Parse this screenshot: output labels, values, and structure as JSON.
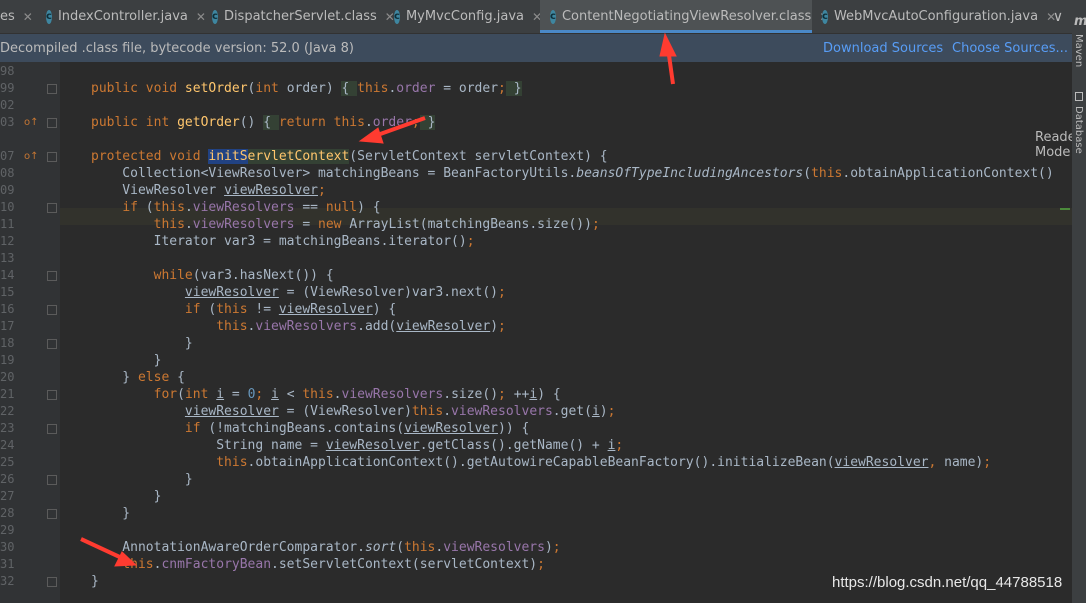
{
  "tabs": [
    {
      "label": "es",
      "icon": "none"
    },
    {
      "label": "IndexController.java",
      "icon": "class-icon"
    },
    {
      "label": "DispatcherServlet.class",
      "icon": "class-icon"
    },
    {
      "label": "MyMvcConfig.java",
      "icon": "class-icon"
    },
    {
      "label": "ContentNegotiatingViewResolver.class",
      "icon": "class-icon",
      "active": true
    },
    {
      "label": "WebMvcAutoConfiguration.java",
      "icon": "class-icon"
    }
  ],
  "banner": {
    "info": "Decompiled .class file, bytecode version: 52.0 (Java 8)",
    "download": "Download Sources",
    "choose": "Choose Sources..."
  },
  "reader_mode": "Reader Mode",
  "sidebar": {
    "maven": "Maven",
    "database": "Database"
  },
  "line_numbers": [
    "98",
    "99",
    "02",
    "03",
    "",
    "07",
    "08",
    "09",
    "10",
    "11",
    "12",
    "13",
    "14",
    "15",
    "16",
    "17",
    "18",
    "19",
    "20",
    "21",
    "22",
    "23",
    "24",
    "25",
    "26",
    "27",
    "28",
    "29",
    "30",
    "31",
    "32"
  ],
  "watermark": "https://blog.csdn.net/qq_44788518",
  "colors": {
    "keyword": "#cc7832",
    "function": "#ffc66d",
    "field": "#9876aa",
    "number": "#6897bb",
    "text": "#a9b7c6",
    "arrow": "#ff3b30"
  }
}
